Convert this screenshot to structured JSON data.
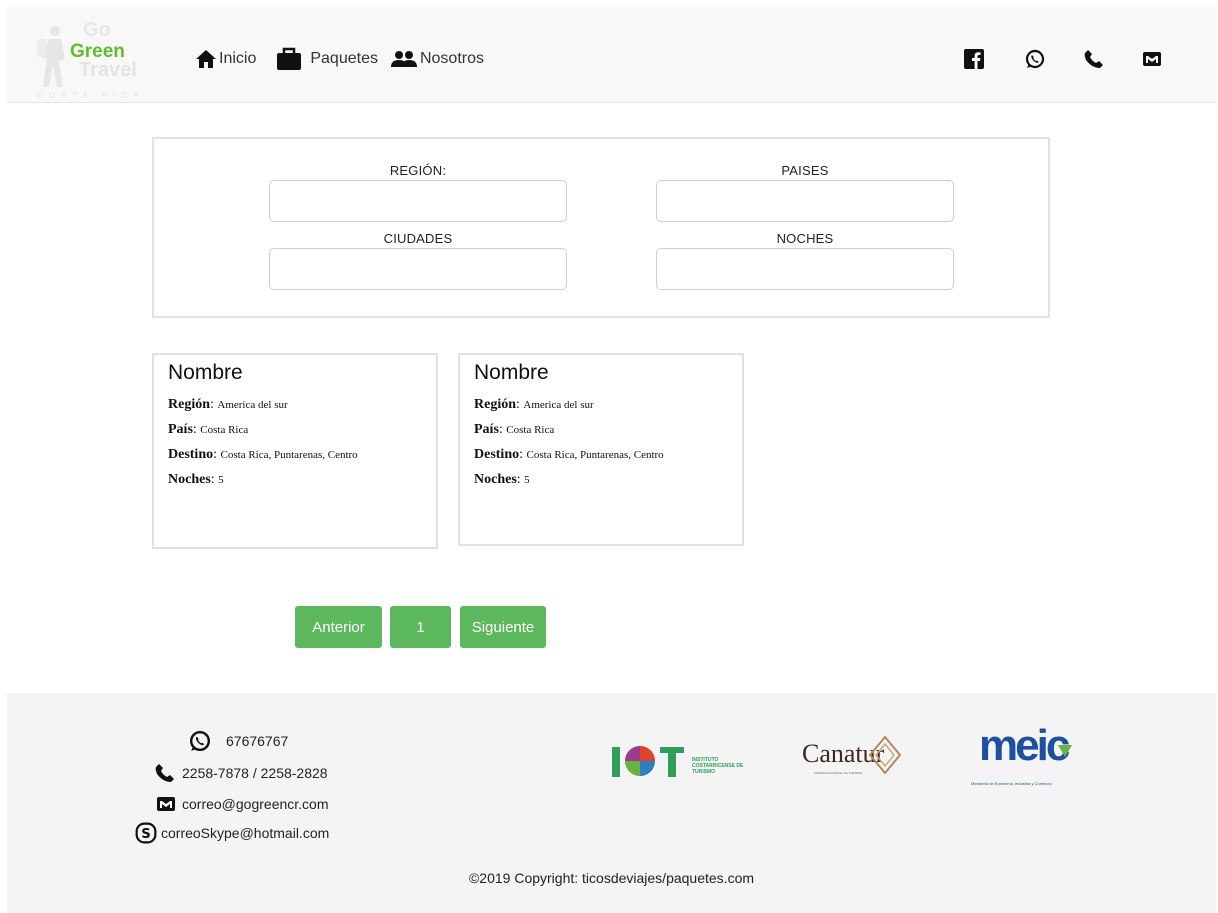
{
  "brand": {
    "go": "Go",
    "green": "Green",
    "travel": "Travel",
    "sub": "COSTA RICA"
  },
  "nav": {
    "items": [
      {
        "label": "Inicio",
        "icon": "home-icon"
      },
      {
        "label": "Paquetes",
        "icon": "briefcase-icon"
      },
      {
        "label": "Nosotros",
        "icon": "people-icon"
      }
    ]
  },
  "social": [
    "facebook-icon",
    "whatsapp-icon",
    "phone-icon",
    "mail-icon"
  ],
  "filters": {
    "region_label": "REGIÓN:",
    "paises_label": "PAISES",
    "ciudades_label": "CIUDADES",
    "noches_label": "NOCHES",
    "region_value": "",
    "paises_value": "",
    "ciudades_value": "",
    "noches_value": ""
  },
  "cards": [
    {
      "title": "Nombre",
      "region_label": "Región",
      "region": "America del sur",
      "pais_label": "País",
      "pais": "Costa Rica",
      "destino_label": "Destino",
      "destino": "Costa Rica, Puntarenas,  Centro",
      "noches_label": "Noches",
      "noches": "5"
    },
    {
      "title": "Nombre",
      "region_label": "Región",
      "region": "America del sur",
      "pais_label": "País",
      "pais": "Costa Rica",
      "destino_label": "Destino",
      "destino": "Costa Rica, Puntarenas,  Centro",
      "noches_label": "Noches",
      "noches": "5"
    }
  ],
  "pagination": {
    "prev": "Anterior",
    "page": "1",
    "next": "Siguiente"
  },
  "footer": {
    "whatsapp": "67676767",
    "phone": "2258-7878 / 2258-2828",
    "email": "correo@gogreencr.com",
    "skype": "correoSkype@hotmail.com",
    "copyright": "©2019 Copyright: ticosdeviajes/paquetes.com",
    "logos": {
      "ict_line1": "INSTITUTO",
      "ict_line2": "COSTARRICENSE DE",
      "ict_line3": "TURISMO",
      "canatur": "Canatur",
      "canatur_sub": "CÁMARA NACIONAL DE TURISMO",
      "meic": "meic",
      "meic_sub": "Ministerio de Economía, Industria y Comercio"
    }
  },
  "colors": {
    "accent": "#5cb85c",
    "brand_green": "#5fbf2a"
  }
}
